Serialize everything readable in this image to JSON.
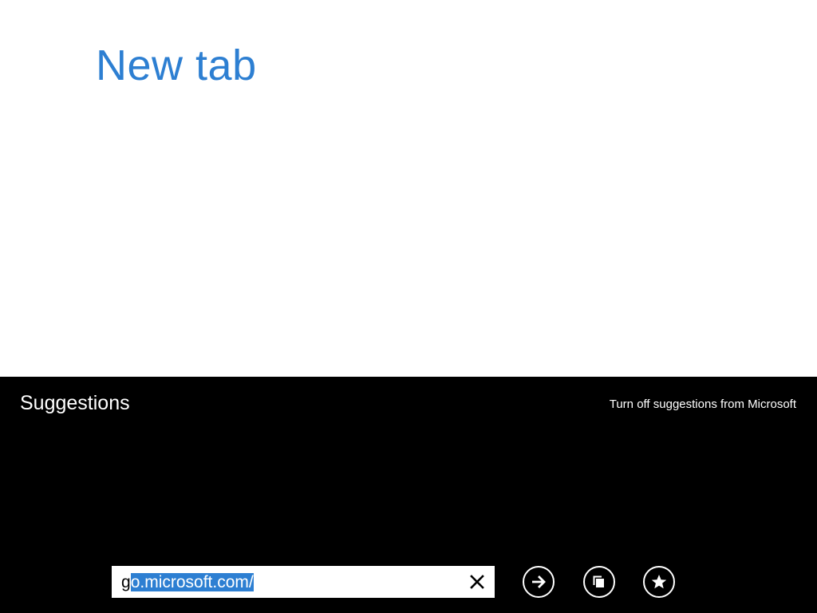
{
  "page": {
    "title": "New tab"
  },
  "suggestions": {
    "title": "Suggestions",
    "turn_off_label": "Turn off suggestions from Microsoft"
  },
  "address_bar": {
    "value_prefix": "g",
    "value_selected": "o.microsoft.com/"
  },
  "buttons": {
    "clear_icon": "close-icon",
    "go_icon": "arrow-right-icon",
    "tabs_icon": "tabs-icon",
    "favorites_icon": "star-icon"
  },
  "colors": {
    "accent": "#2d7fd2",
    "panel_bg": "#000000",
    "page_bg": "#ffffff",
    "selection": "#2d7fd2"
  }
}
